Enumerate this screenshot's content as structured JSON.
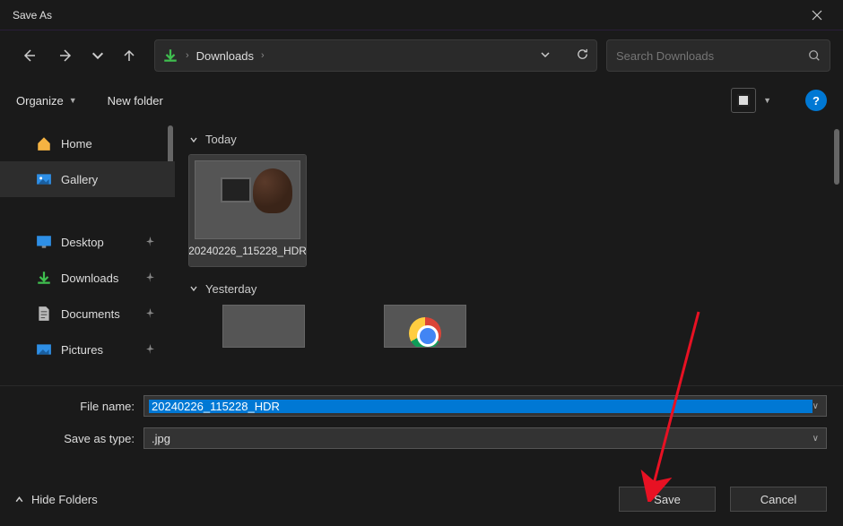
{
  "titlebar": {
    "title": "Save As"
  },
  "nav": {
    "breadcrumb": "Downloads",
    "search_placeholder": "Search Downloads"
  },
  "toolbar": {
    "organize": "Organize",
    "new_folder": "New folder",
    "help": "?"
  },
  "sidebar": {
    "home": "Home",
    "gallery": "Gallery",
    "desktop": "Desktop",
    "downloads": "Downloads",
    "documents": "Documents",
    "pictures": "Pictures"
  },
  "content": {
    "group_today": "Today",
    "group_yesterday": "Yesterday",
    "file1": "20240226_115228_HDR"
  },
  "form": {
    "filename_label": "File name:",
    "filename_value": "20240226_115228_HDR",
    "savetype_label": "Save as type:",
    "savetype_value": ".jpg"
  },
  "bottom": {
    "hide_folders": "Hide Folders",
    "save": "Save",
    "cancel": "Cancel"
  }
}
